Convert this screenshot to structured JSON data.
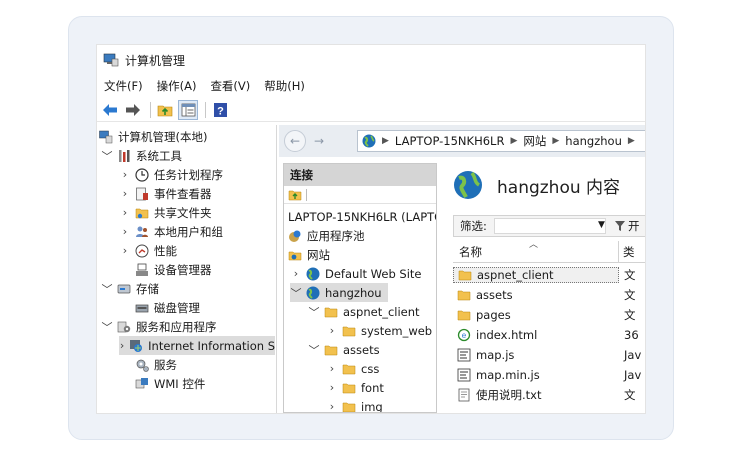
{
  "window": {
    "title": "计算机管理"
  },
  "menu": [
    "文件(F)",
    "操作(A)",
    "查看(V)",
    "帮助(H)"
  ],
  "toolbar": {
    "buttons": [
      "back-arrow",
      "forward-arrow",
      "folder-up",
      "properties",
      "help"
    ]
  },
  "left_tree": [
    {
      "label": "计算机管理(本地)",
      "icon": "computer-mgmt-icon",
      "expander": ""
    },
    {
      "label": "系统工具",
      "icon": "tools-icon",
      "expander": "﹀"
    },
    {
      "label": "任务计划程序",
      "icon": "clock-icon",
      "expander": "›"
    },
    {
      "label": "事件查看器",
      "icon": "event-viewer-icon",
      "expander": "›"
    },
    {
      "label": "共享文件夹",
      "icon": "shared-folder-icon",
      "expander": "›"
    },
    {
      "label": "本地用户和组",
      "icon": "users-icon",
      "expander": "›"
    },
    {
      "label": "性能",
      "icon": "performance-icon",
      "expander": "›"
    },
    {
      "label": "设备管理器",
      "icon": "device-manager-icon",
      "expander": ""
    },
    {
      "label": "存储",
      "icon": "storage-icon",
      "expander": "﹀"
    },
    {
      "label": "磁盘管理",
      "icon": "disk-icon",
      "expander": ""
    },
    {
      "label": "服务和应用程序",
      "icon": "services-apps-icon",
      "expander": "﹀"
    },
    {
      "label": "Internet Information S",
      "icon": "iis-icon",
      "expander": "›"
    },
    {
      "label": "服务",
      "icon": "services-icon",
      "expander": ""
    },
    {
      "label": "WMI 控件",
      "icon": "wmi-icon",
      "expander": ""
    }
  ],
  "address_bar": {
    "segments": [
      "LAPTOP-15NKH6LR",
      "网站",
      "hangzhou"
    ]
  },
  "connections": {
    "header": "连接",
    "tree": [
      {
        "label": "LAPTOP-15NKH6LR (LAPTO",
        "icon": "",
        "expander": ""
      },
      {
        "label": "应用程序池",
        "icon": "app-pool-icon",
        "expander": ""
      },
      {
        "label": "网站",
        "icon": "sites-icon",
        "expander": ""
      },
      {
        "label": "Default Web Site",
        "icon": "globe-icon",
        "expander": "›"
      },
      {
        "label": "hangzhou",
        "icon": "globe-icon",
        "expander": "﹀"
      },
      {
        "label": "aspnet_client",
        "icon": "folder-icon",
        "expander": "﹀"
      },
      {
        "label": "system_web",
        "icon": "folder-icon",
        "expander": "›"
      },
      {
        "label": "assets",
        "icon": "folder-icon",
        "expander": "﹀"
      },
      {
        "label": "css",
        "icon": "folder-icon",
        "expander": "›"
      },
      {
        "label": "font",
        "icon": "folder-icon",
        "expander": "›"
      },
      {
        "label": "img",
        "icon": "folder-icon",
        "expander": "›"
      }
    ]
  },
  "content": {
    "title": "hangzhou 内容",
    "filter_label": "筛选:",
    "filter_go": "开",
    "columns": [
      "名称",
      "类"
    ],
    "files": [
      {
        "name": "aspnet_client",
        "type": "文",
        "icon": "folder-icon"
      },
      {
        "name": "assets",
        "type": "文",
        "icon": "folder-icon"
      },
      {
        "name": "pages",
        "type": "文",
        "icon": "folder-icon"
      },
      {
        "name": "index.html",
        "type": "36",
        "icon": "html-file-icon"
      },
      {
        "name": "map.js",
        "type": "Jav",
        "icon": "js-file-icon"
      },
      {
        "name": "map.min.js",
        "type": "Jav",
        "icon": "js-file-icon"
      },
      {
        "name": "使用说明.txt",
        "type": "文",
        "icon": "text-file-icon"
      }
    ]
  },
  "colors": {
    "folder": "#f2c14e",
    "globe": "#1f6fb7",
    "accent": "#2b79d0",
    "selection": "#dcdcdc"
  }
}
